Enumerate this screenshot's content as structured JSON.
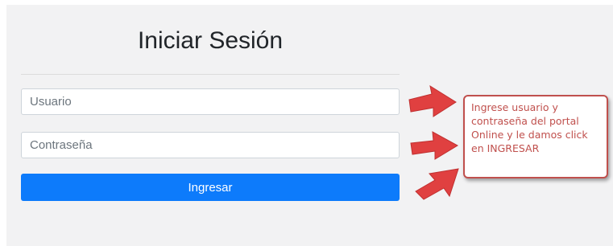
{
  "login": {
    "title": "Iniciar Sesión",
    "username_placeholder": "Usuario",
    "password_placeholder": "Contraseña",
    "submit_label": "Ingresar"
  },
  "annotation": {
    "text": "Ingrese usuario y contraseña del portal Online y le damos click en INGRESAR",
    "color": "#c0504d",
    "arrow_color": "#e04040"
  },
  "colors": {
    "button_bg": "#0d7bfb",
    "panel_bg": "#f2f2f3"
  }
}
